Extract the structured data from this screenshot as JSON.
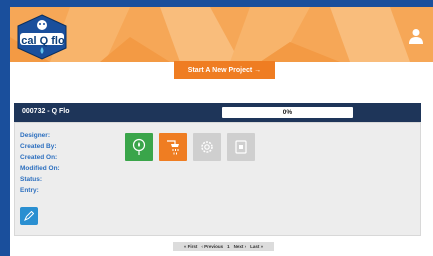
{
  "logo": {
    "text": "cal Q flo"
  },
  "header": {
    "start_button": "Start A New Project →"
  },
  "project": {
    "title": "000732 - Q Flo",
    "progress_label": "0%",
    "fields": [
      "Designer:",
      "Created By:",
      "Created On:",
      "Modified On:",
      "Status:",
      "Entry:"
    ],
    "tiles": [
      {
        "icon": "tap-water-icon",
        "color": "#3aa54a",
        "state": "active"
      },
      {
        "icon": "shower-icon",
        "color": "#ef7d22",
        "state": "active"
      },
      {
        "icon": "gear-icon",
        "color": "#cfcfcf",
        "state": "disabled"
      },
      {
        "icon": "water-heater-icon",
        "color": "#cfcfcf",
        "state": "disabled"
      }
    ]
  },
  "pagination": {
    "first": "« First",
    "previous": "‹ Previous",
    "page": "1",
    "next": "Next ›",
    "last": "Last »"
  },
  "colors": {
    "frame": "#1a4f9c",
    "banner": "#f6a757",
    "header_bar": "#1e3559",
    "button": "#ef7d22",
    "label": "#2c6fbf"
  }
}
